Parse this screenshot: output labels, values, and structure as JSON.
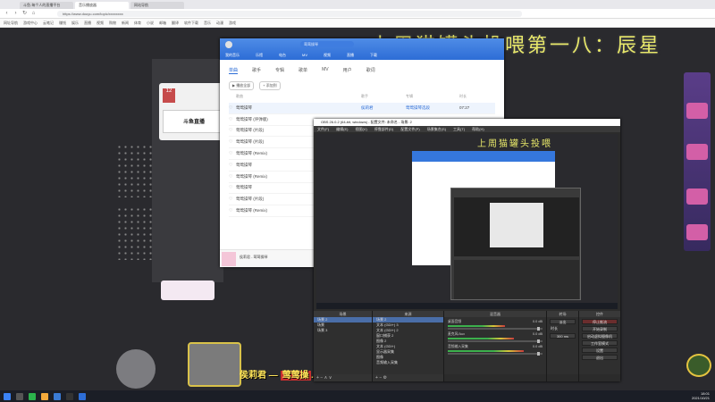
{
  "browser": {
    "tabs": [
      {
        "label": "斗鱼-每个人的直播平台",
        "active": false
      },
      {
        "label": "音乐播放器",
        "active": true
      },
      {
        "label": "网站导航",
        "active": false
      }
    ],
    "address": "https://www.douyu.com/topic/xxxxxxxx",
    "nav": {
      "back": "‹",
      "forward": "›",
      "refresh": "↻",
      "home": "⌂"
    },
    "bookmarks": [
      "网址导航",
      "游戏中心",
      "云笔记",
      "赚钱",
      "娱乐",
      "直播",
      "视频",
      "购物",
      "新闻",
      "体育",
      "小说",
      "邮箱",
      "翻译",
      "软件下载",
      "音乐",
      "动漫",
      "游戏"
    ]
  },
  "stream": {
    "banner": "上周猫罐头投喂第一八：辰星",
    "bg_card_title": "斗鱼直播",
    "bg_card_badge": "12",
    "subtitle_prefix": "侯莉君",
    "subtitle_highlight": "莺莺操",
    "subtitle_suffix": "…"
  },
  "music": {
    "search_placeholder": "莺莺操琴",
    "nav": [
      "我的音乐",
      "乐馆",
      "电台",
      "MV",
      "视频",
      "直播",
      "下载"
    ],
    "tabs": [
      "单曲",
      "歌手",
      "专辑",
      "歌单",
      "MV",
      "用户",
      "歌词"
    ],
    "active_tab": "单曲",
    "actions": [
      "▶ 播放全部",
      "+ 添加到"
    ],
    "header": {
      "title": "歌曲",
      "artist": "歌手",
      "album": "专辑",
      "duration": "时长"
    },
    "songs": [
      {
        "title": "莺莺操琴",
        "artist": "侯莉君",
        "album": "莺莺操琴选段",
        "duration": "07:27"
      },
      {
        "title": "莺莺操琴 (评弹版)",
        "artist": "",
        "album": "",
        "duration": ""
      },
      {
        "title": "莺莺操琴 (片段)",
        "artist": "",
        "album": "",
        "duration": ""
      },
      {
        "title": "莺莺操琴 (片段)",
        "artist": "",
        "album": "",
        "duration": ""
      },
      {
        "title": "莺莺操琴 (Remix)",
        "artist": "",
        "album": "",
        "duration": ""
      },
      {
        "title": "莺莺操琴",
        "artist": "",
        "album": "",
        "duration": ""
      },
      {
        "title": "莺莺操琴 (Remix)",
        "artist": "",
        "album": "",
        "duration": ""
      },
      {
        "title": "莺莺操琴",
        "artist": "",
        "album": "",
        "duration": ""
      },
      {
        "title": "莺莺操琴 (片段)",
        "artist": "",
        "album": "",
        "duration": ""
      },
      {
        "title": "莺莺操琴 (Remix)",
        "artist": "",
        "album": "",
        "duration": ""
      }
    ],
    "now_playing": "侯莉君 - 莺莺操琴"
  },
  "obs": {
    "title": "OBS 26.0.2 (64-bit, windows) - 配置文件: 未命名 - 场景: 2",
    "menu": [
      "文件(F)",
      "编辑(E)",
      "视图(V)",
      "停靠部件(D)",
      "配置文件(P)",
      "场景集合(S)",
      "工具(T)",
      "帮助(H)"
    ],
    "preview_banner": "上周猫罐头投喂",
    "docks": {
      "scenes": {
        "title": "场景",
        "items": [
          "场景 2",
          "场景",
          "场景 3"
        ],
        "selected": 0
      },
      "sources": {
        "title": "来源",
        "items": [
          "场景 2",
          "文本 (GDI+) 3",
          "文本 (GDI+) 2",
          "窗口捕获 2",
          "图像 2",
          "文本 (GDI+)",
          "显示器采集",
          "图像",
          "音频输入采集"
        ],
        "selected": 0
      },
      "mixer": {
        "title": "混音器",
        "channels": [
          {
            "name": "桌面音频",
            "db": "0.0 dB"
          },
          {
            "name": "麦克风/Aux",
            "db": "0.0 dB"
          },
          {
            "name": "音频输入采集",
            "db": "0.0 dB"
          }
        ]
      },
      "transitions": {
        "title": "转场",
        "type": "淡出",
        "duration_label": "时长",
        "duration": "300 ms"
      },
      "controls": {
        "title": "控件",
        "buttons": [
          "停止推流",
          "开始录制",
          "启动虚拟摄像机",
          "工作室模式",
          "设置",
          "退出"
        ]
      }
    },
    "footer_icons": [
      "+",
      "−",
      "⚙",
      "∧",
      "∨"
    ]
  },
  "taskbar": {
    "time": "18:01",
    "date": "2021/10/21"
  },
  "colors": {
    "accent_blue": "#2d6dd6",
    "banner_yellow": "#e8e86a",
    "obs_bg": "#2b2b2b"
  }
}
